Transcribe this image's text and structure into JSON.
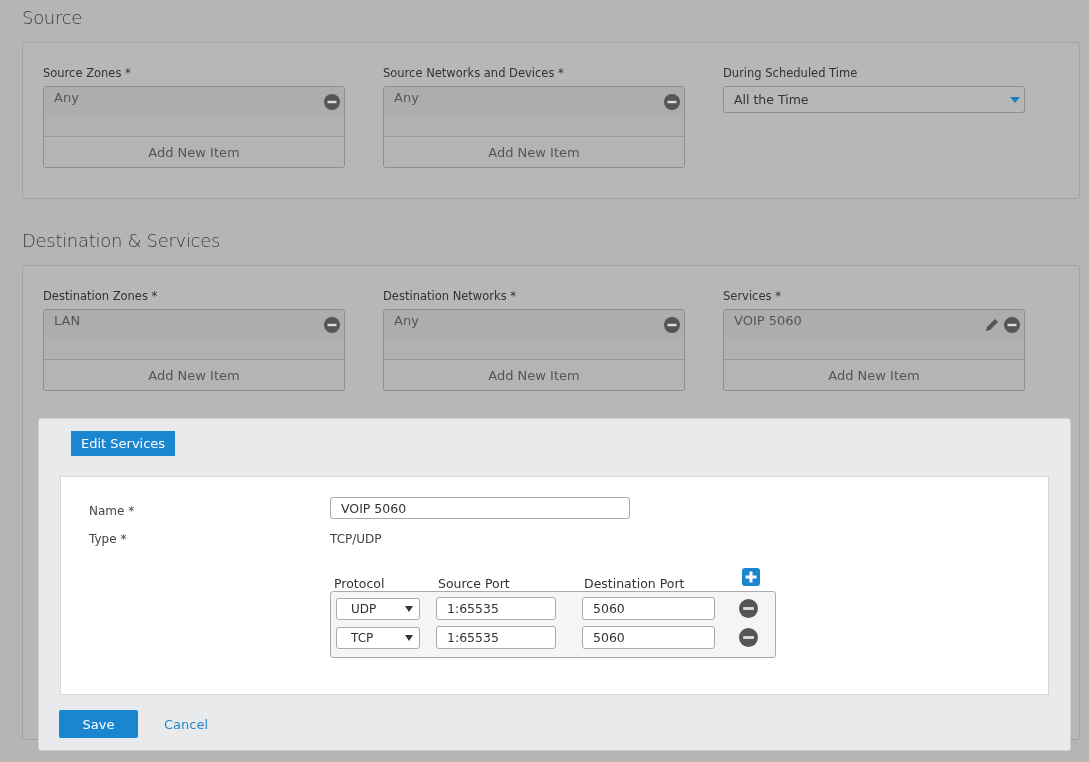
{
  "sections": [
    {
      "title": "Source",
      "fields": [
        {
          "kind": "list",
          "label": "Source Zones *",
          "items": [
            {
              "text": "Any",
              "editable": false
            }
          ],
          "add_label": "Add New Item"
        },
        {
          "kind": "list",
          "label": "Source Networks and Devices *",
          "items": [
            {
              "text": "Any",
              "editable": false
            }
          ],
          "add_label": "Add New Item"
        },
        {
          "kind": "select",
          "label": "During Scheduled Time",
          "value": "All the Time"
        }
      ]
    },
    {
      "title": "Destination & Services",
      "fields": [
        {
          "kind": "list",
          "label": "Destination Zones *",
          "items": [
            {
              "text": "LAN",
              "editable": false
            }
          ],
          "add_label": "Add New Item"
        },
        {
          "kind": "list",
          "label": "Destination Networks *",
          "items": [
            {
              "text": "Any",
              "editable": false
            }
          ],
          "add_label": "Add New Item"
        },
        {
          "kind": "list",
          "label": "Services *",
          "items": [
            {
              "text": "VOIP 5060",
              "editable": true
            }
          ],
          "add_label": "Add New Item"
        }
      ]
    }
  ],
  "dialog": {
    "tab": "Edit Services",
    "name_label": "Name *",
    "name_value": "VOIP 5060",
    "type_label": "Type *",
    "type_value": "TCP/UDP",
    "columns": [
      "Protocol",
      "Source Port",
      "Destination Port"
    ],
    "rows": [
      {
        "protocol": "UDP",
        "source_port": "1:65535",
        "destination_port": "5060"
      },
      {
        "protocol": "TCP",
        "source_port": "1:65535",
        "destination_port": "5060"
      }
    ],
    "save": "Save",
    "cancel": "Cancel"
  }
}
